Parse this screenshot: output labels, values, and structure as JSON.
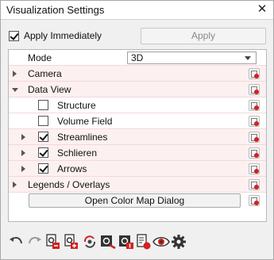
{
  "window": {
    "title": "Visualization Settings",
    "close_glyph": "✕"
  },
  "apply": {
    "checkbox_label": "Apply Immediately",
    "checked": true,
    "button_label": "Apply"
  },
  "tree": {
    "mode": {
      "label": "Mode",
      "value": "3D"
    },
    "camera": {
      "label": "Camera"
    },
    "data_view": {
      "label": "Data View",
      "items": [
        {
          "label": "Structure",
          "checked": false
        },
        {
          "label": "Volume Field",
          "checked": false
        },
        {
          "label": "Streamlines",
          "checked": true
        },
        {
          "label": "Schlieren",
          "checked": true
        },
        {
          "label": "Arrows",
          "checked": true
        }
      ]
    },
    "legends": {
      "label": "Legends / Overlays"
    },
    "open_color_map": {
      "label": "Open Color Map Dialog"
    }
  },
  "toolbar": {
    "icons": [
      "undo-icon",
      "redo-icon",
      "load-settings-icon",
      "save-settings-icon",
      "sync-icon",
      "settings-export-icon",
      "settings-import-icon",
      "reset-file-icon",
      "visibility-icon",
      "gear-icon"
    ]
  },
  "colors": {
    "reset_red": "#d42020",
    "row_pink": "#fdf0f0"
  }
}
